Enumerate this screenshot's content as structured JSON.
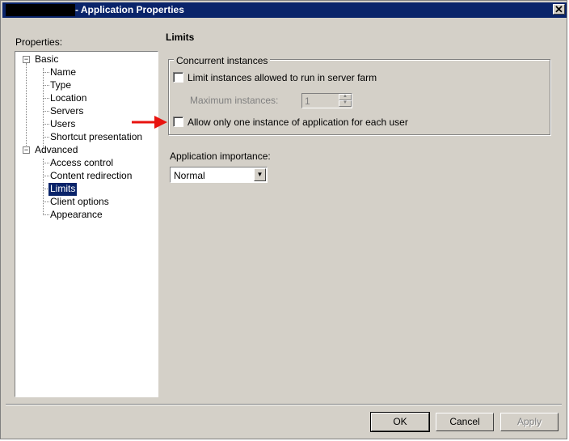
{
  "window": {
    "title": "- Application Properties",
    "close_glyph": "✕"
  },
  "left_panel": {
    "label": "Properties:",
    "tree": {
      "groups": [
        {
          "label": "Basic",
          "expander": "−",
          "items": [
            "Name",
            "Type",
            "Location",
            "Servers",
            "Users",
            "Shortcut presentation"
          ]
        },
        {
          "label": "Advanced",
          "expander": "−",
          "items": [
            "Access control",
            "Content redirection",
            "Limits",
            "Client options",
            "Appearance"
          ]
        }
      ],
      "selected": "Limits"
    }
  },
  "right_panel": {
    "heading": "Limits",
    "concurrent": {
      "group_title": "Concurrent instances",
      "limit_checkbox_label": "Limit instances allowed to run in server farm",
      "limit_checked": false,
      "max_label": "Maximum instances:",
      "max_value": "1",
      "one_per_user_label": "Allow only one instance of application for each user",
      "one_per_user_checked": false
    },
    "importance": {
      "label": "Application importance:",
      "value": "Normal"
    }
  },
  "buttons": {
    "ok": "OK",
    "cancel": "Cancel",
    "apply": "Apply"
  },
  "colors": {
    "titlebar": "#0a246a",
    "selection": "#0a246a",
    "arrow": "#e8130f",
    "face": "#d4d0c8"
  },
  "icons": {
    "arrow": "red-arrow-icon"
  }
}
